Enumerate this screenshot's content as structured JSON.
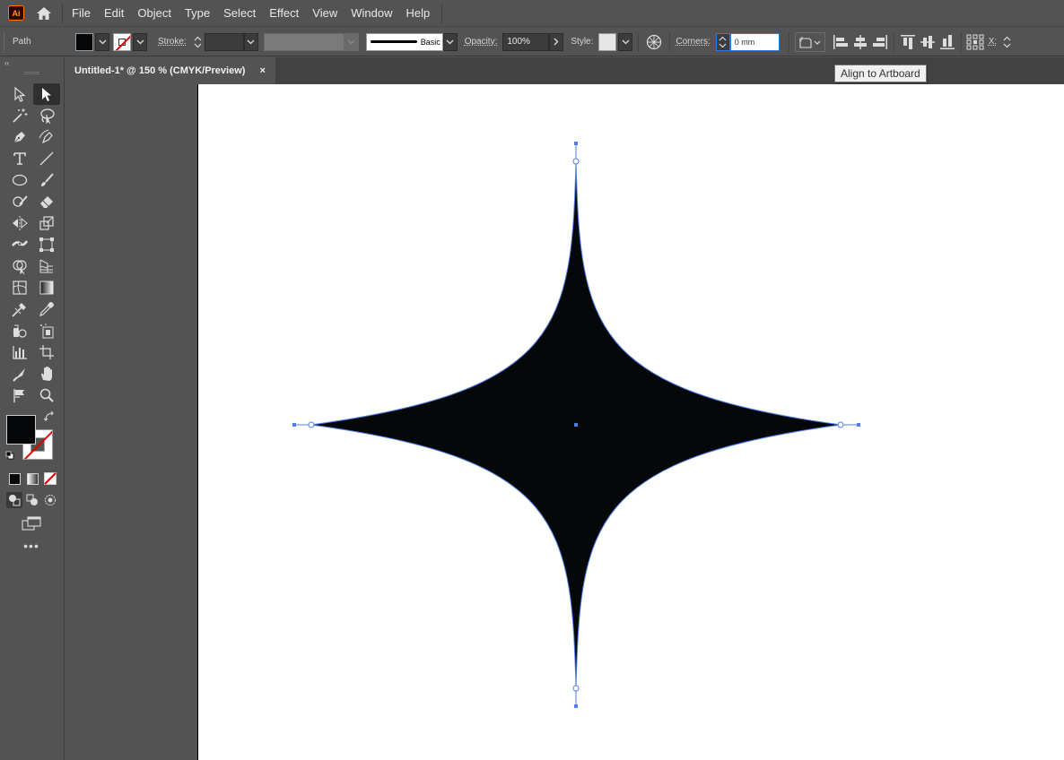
{
  "app": {
    "logo_text": "Ai"
  },
  "menu": [
    "File",
    "Edit",
    "Object",
    "Type",
    "Select",
    "Effect",
    "View",
    "Window",
    "Help"
  ],
  "control_bar": {
    "selection_label": "Path",
    "stroke_label": "Stroke:",
    "brush_label": "Basic",
    "opacity_label": "Opacity:",
    "opacity_value": "100%",
    "style_label": "Style:",
    "corners_label": "Corners:",
    "corners_value": "0 mm",
    "x_label": "X:"
  },
  "tooltip": {
    "text": "Align to Artboard"
  },
  "document_tab": {
    "title": "Untitled-1* @ 150 % (CMYK/Preview)",
    "close": "×"
  },
  "toolpanel": {
    "collapse_glyph": "‹‹",
    "more_glyph": "•••"
  },
  "colors": {
    "fill": "#060708",
    "selection": "#4f7fe6",
    "ui_bg": "#535353",
    "artboard": "#ffffff"
  }
}
